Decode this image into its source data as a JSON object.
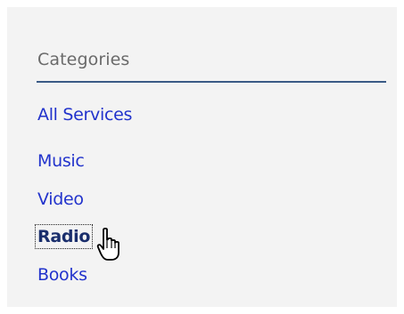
{
  "categories": {
    "heading": "Categories",
    "items": [
      {
        "label": "All Services"
      },
      {
        "label": "Music"
      },
      {
        "label": "Video"
      },
      {
        "label": "Radio"
      },
      {
        "label": "Books"
      }
    ],
    "active_index": 3
  },
  "cursor": {
    "icon": "hand-pointer-icon"
  },
  "colors": {
    "link": "#2233cc",
    "link_active": "#1a2e6c",
    "heading": "#6a6a6a",
    "rule": "#3a5b86",
    "panel_bg": "#f3f3f3"
  }
}
